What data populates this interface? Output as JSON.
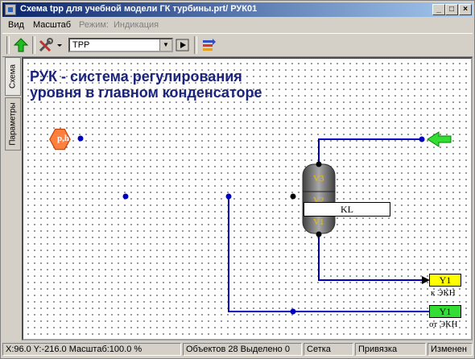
{
  "window": {
    "title": "Схема tpp для учебной модели ГК турбины.prt/ РУК01",
    "minimize": "_",
    "maximize": "□",
    "close": "×"
  },
  "menu": {
    "view": "Вид",
    "scale": "Масштаб",
    "mode_label": "Режим:",
    "mode_value": "Индикация"
  },
  "toolbar": {
    "combo_value": "TPP",
    "icons": [
      "up-arrow-icon",
      "tools-icon",
      "play-icon",
      "swap-icon"
    ]
  },
  "side_tabs": {
    "schema": "Схема",
    "params": "Параметры"
  },
  "diagram": {
    "heading_line1": "РУК - система регулирования",
    "heading_line2": "уровня в главном конденсаторе",
    "hex_label": "p,h",
    "valve_v3": "V3",
    "valve_v2": "V2",
    "valve_v1": "V1",
    "kl_label": "KL",
    "y1_top": "Y1",
    "y1_top_sub": "к ЭКН",
    "y1_bottom": "Y1",
    "y1_bottom_sub": "от ЭКН",
    "colors": {
      "wire": "#0000c0",
      "heading": "#1a237e",
      "hex": "#ff7f3f",
      "arrow": "#33dd33",
      "yellow_box": "#ffff00",
      "green_box": "#33dd33"
    }
  },
  "status": {
    "coords": "X:96.0  Y:-216.0  Масштаб:100.0 %",
    "objects": "Объектов 28  Выделено 0",
    "grid": "Сетка",
    "snap": "Привязка",
    "changed": "Изменен"
  }
}
